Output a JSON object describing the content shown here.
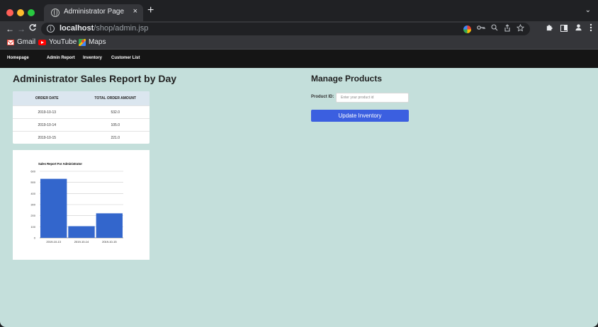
{
  "browser": {
    "tab_title": "Administrator Page",
    "tab_close": "×",
    "new_tab": "+",
    "tab_menu": "⌄",
    "nav_back": "←",
    "nav_forward": "→",
    "nav_reload": "C",
    "url_host": "localhost",
    "url_path": "/shop/admin.jsp",
    "info_icon": "i",
    "omnibox_icons": [
      "google-lens-icon",
      "key-icon",
      "zoom-icon",
      "share-icon",
      "star-icon"
    ],
    "toolbar_icons": [
      "extensions-icon",
      "side-panel-icon",
      "profile-icon",
      "menu-icon"
    ],
    "bookmarks": [
      {
        "label": "Gmail",
        "icon": "gmail-icon"
      },
      {
        "label": "YouTube",
        "icon": "youtube-icon"
      },
      {
        "label": "Maps",
        "icon": "maps-icon"
      }
    ]
  },
  "site_nav": {
    "links": [
      "Homepage",
      "Admin Report",
      "Inventory",
      "Customer List"
    ]
  },
  "report": {
    "title": "Administrator Sales Report by Day",
    "columns": [
      "ORDER DATE",
      "TOTAL ORDER AMOUNT"
    ],
    "rows": [
      [
        "2019-10-13",
        "532.0"
      ],
      [
        "2019-10-14",
        "105.0"
      ],
      [
        "2019-10-15",
        "221.0"
      ]
    ]
  },
  "chart_data": {
    "type": "bar",
    "title": "Sales Report For Administrator",
    "categories": [
      "2019-10-13",
      "2019-10-14",
      "2019-10-15"
    ],
    "values": [
      532,
      105,
      221
    ],
    "ylim": [
      0,
      600
    ],
    "yticks": [
      0,
      100,
      200,
      300,
      400,
      500,
      600
    ],
    "grid": true,
    "bar_color": "#3366cc"
  },
  "manage": {
    "title": "Manage Products",
    "product_id_label": "Product ID:",
    "product_id_placeholder": "Enter your product id",
    "product_id_value": "",
    "update_button": "Update Inventory"
  },
  "colors": {
    "page_background": "#c4dfdb",
    "nav_background": "#151515",
    "button_blue": "#3b5fe0",
    "table_header": "#dbe6ef"
  }
}
